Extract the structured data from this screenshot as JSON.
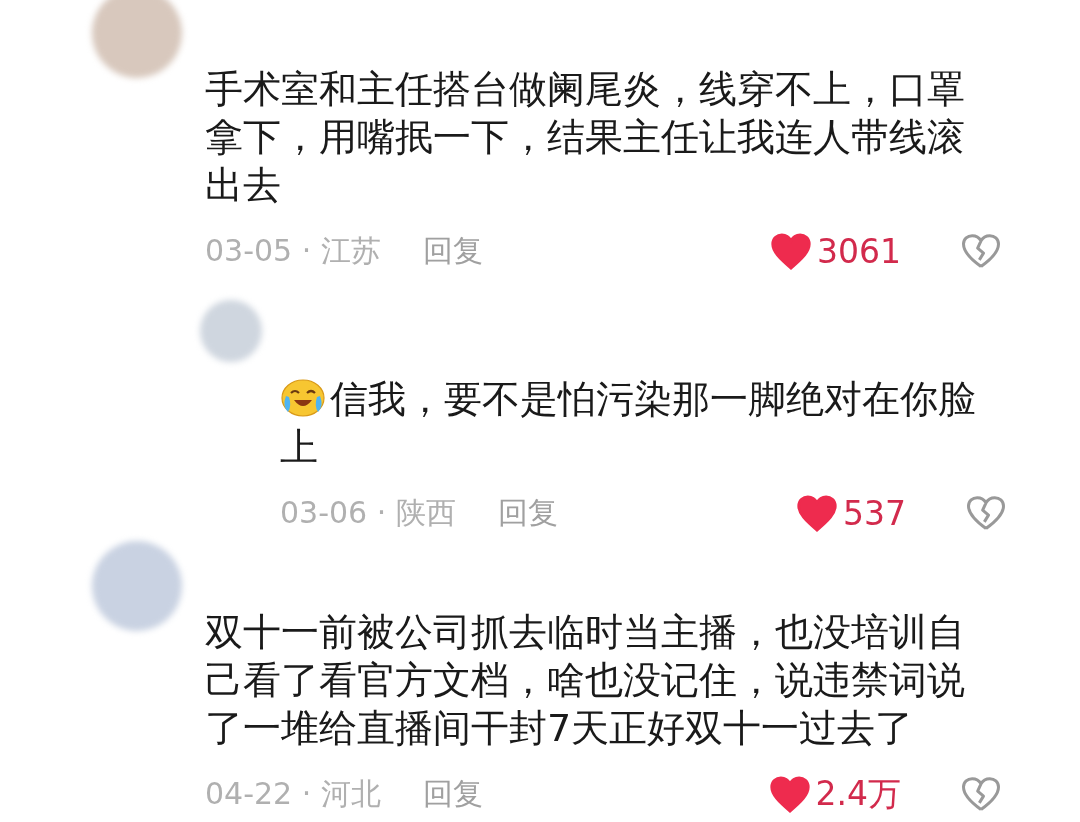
{
  "comments": [
    {
      "kind": "comment",
      "text": "手术室和主任搭台做阑尾炎，线穿不上，口罩拿下，用嘴抿一下，结果主任让我连人带线滚出去",
      "meta": "03-05 · 江苏",
      "reply_label": "回复",
      "likes": "3061",
      "liked": true
    },
    {
      "kind": "reply",
      "text": "信我，要不是怕污染那一脚绝对在你脸上",
      "has_emoji": true,
      "meta": "03-06 · 陕西",
      "reply_label": "回复",
      "likes": "537",
      "liked": true
    },
    {
      "kind": "comment",
      "text": "双十一前被公司抓去临时当主播，也没培训自己看了看官方文档，啥也没记住，说违禁词说了一堆给直播间干封7天正好双十一过去了",
      "meta": "04-22 · 河北",
      "reply_label": "回复",
      "likes": "2.4万",
      "liked": true
    }
  ]
}
